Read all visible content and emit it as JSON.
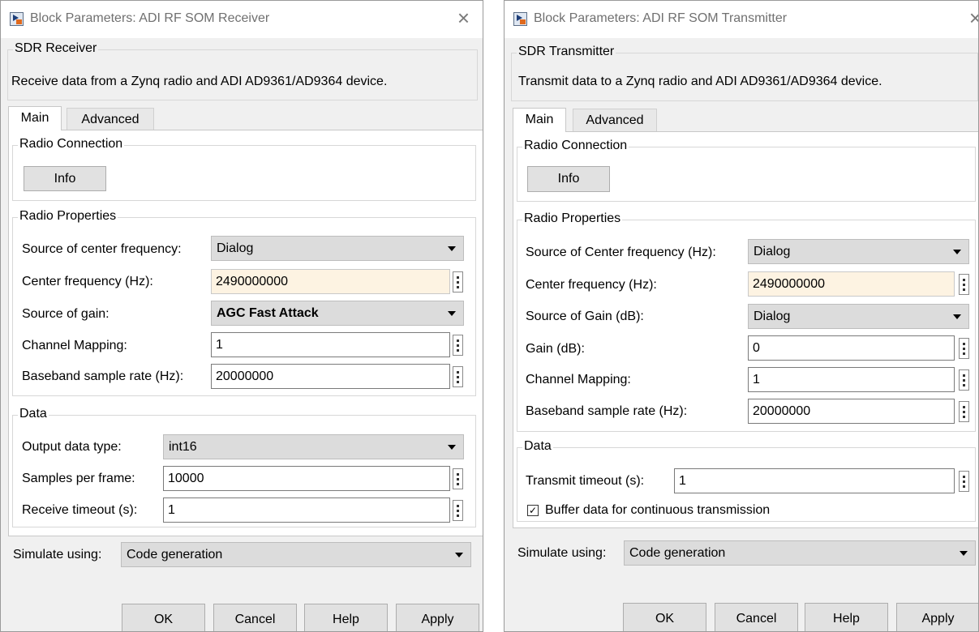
{
  "receiver": {
    "window_title": "Block Parameters: ADI RF SOM Receiver",
    "group_title": "SDR Receiver",
    "description": "Receive data from a Zynq radio and ADI AD9361/AD9364 device.",
    "tabs": [
      "Main",
      "Advanced"
    ],
    "radio_connection": {
      "title": "Radio Connection",
      "info_button": "Info"
    },
    "radio_properties": {
      "title": "Radio Properties",
      "source_center_freq_label": "Source of center frequency:",
      "source_center_freq_value": "Dialog",
      "center_freq_label": "Center frequency (Hz):",
      "center_freq_value": "2490000000",
      "source_gain_label": "Source of gain:",
      "source_gain_value": "AGC Fast Attack",
      "channel_mapping_label": "Channel Mapping:",
      "channel_mapping_value": "1",
      "baseband_rate_label": "Baseband sample rate (Hz):",
      "baseband_rate_value": "20000000"
    },
    "data": {
      "title": "Data",
      "output_type_label": "Output data type:",
      "output_type_value": "int16",
      "samples_per_frame_label": "Samples per frame:",
      "samples_per_frame_value": "10000",
      "receive_timeout_label": "Receive timeout (s):",
      "receive_timeout_value": "1"
    },
    "simulate_label": "Simulate using:",
    "simulate_value": "Code generation",
    "buttons": {
      "ok": "OK",
      "cancel": "Cancel",
      "help": "Help",
      "apply": "Apply"
    }
  },
  "transmitter": {
    "window_title": "Block Parameters: ADI RF SOM Transmitter",
    "group_title": "SDR Transmitter",
    "description": "Transmit data to a Zynq radio and ADI AD9361/AD9364 device.",
    "tabs": [
      "Main",
      "Advanced"
    ],
    "radio_connection": {
      "title": "Radio Connection",
      "info_button": "Info"
    },
    "radio_properties": {
      "title": "Radio Properties",
      "source_center_freq_label": "Source of Center frequency (Hz):",
      "source_center_freq_value": "Dialog",
      "center_freq_label": "Center frequency (Hz):",
      "center_freq_value": "2490000000",
      "source_gain_label": "Source of Gain (dB):",
      "source_gain_value": "Dialog",
      "gain_label": "Gain (dB):",
      "gain_value": "0",
      "channel_mapping_label": "Channel Mapping:",
      "channel_mapping_value": "1",
      "baseband_rate_label": "Baseband sample rate (Hz):",
      "baseband_rate_value": "20000000"
    },
    "data": {
      "title": "Data",
      "transmit_timeout_label": "Transmit timeout (s):",
      "transmit_timeout_value": "1",
      "buffer_label": "Buffer data for continuous transmission",
      "buffer_checked": true
    },
    "simulate_label": "Simulate using:",
    "simulate_value": "Code generation",
    "buttons": {
      "ok": "OK",
      "cancel": "Cancel",
      "help": "Help",
      "apply": "Apply"
    }
  }
}
